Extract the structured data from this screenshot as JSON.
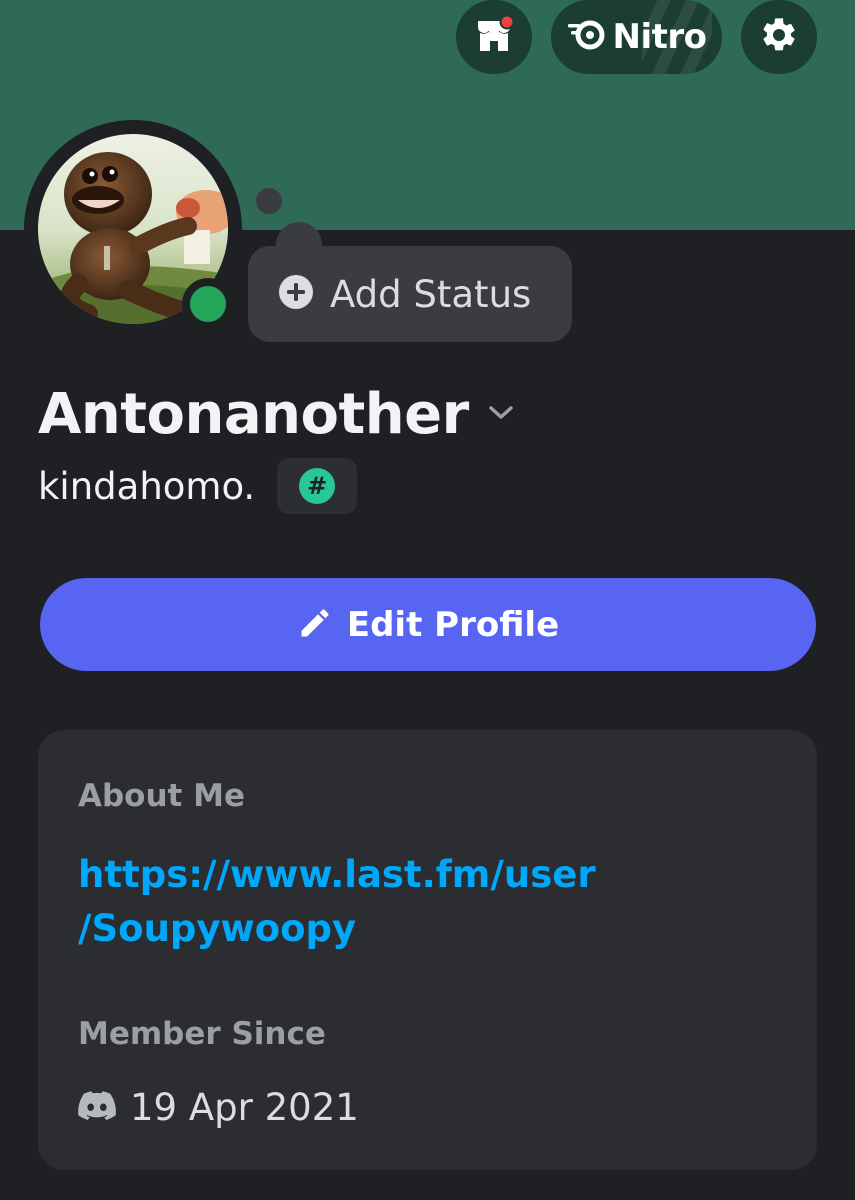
{
  "header": {
    "nitro_label": "Nitro",
    "icons": {
      "shop": "shop-icon",
      "nitro": "nitro-icon",
      "settings": "gear-icon"
    }
  },
  "status": {
    "add_status_label": "Add Status",
    "presence": "online"
  },
  "profile": {
    "display_name": "Antonanother",
    "username": "kindahomo.",
    "edit_label": "Edit Profile"
  },
  "card": {
    "about_title": "About Me",
    "about_link_line1": "https://www.last.fm/user",
    "about_link_line2": "/Soupywoopy",
    "member_since_title": "Member Since",
    "member_since_date": "19 Apr 2021"
  },
  "colors": {
    "banner": "#2e6a56",
    "background": "#1f2024",
    "accent": "#5865f2",
    "online": "#23a55a",
    "link": "#00a8fc"
  }
}
